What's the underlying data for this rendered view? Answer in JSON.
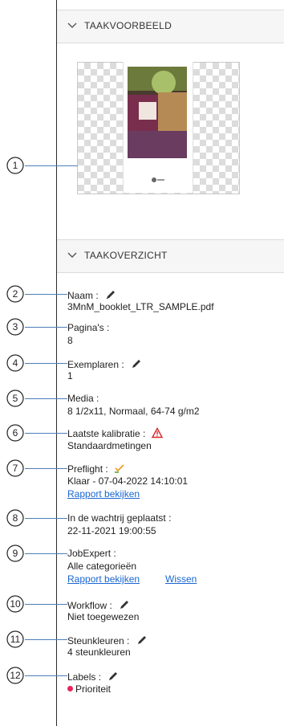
{
  "sections": {
    "preview_title": "TAAKVOORBEELD",
    "summary_title": "TAAKOVERZICHT"
  },
  "callouts": [
    "1",
    "2",
    "3",
    "4",
    "5",
    "6",
    "7",
    "8",
    "9",
    "10",
    "11",
    "12"
  ],
  "fields": {
    "name": {
      "label": "Naam :",
      "value": "3MnM_booklet_LTR_SAMPLE.pdf"
    },
    "pages": {
      "label": "Pagina's :",
      "value": "8"
    },
    "copies": {
      "label": "Exemplaren :",
      "value": "1"
    },
    "media": {
      "label": "Media :",
      "value": "8 1/2x11, Normaal, 64-74 g/m2"
    },
    "calibration": {
      "label": "Laatste kalibratie :",
      "value": "Standaardmetingen"
    },
    "preflight": {
      "label": "Preflight :",
      "value": "Klaar - 07-04-2022 14:10:01",
      "link": "Rapport bekijken"
    },
    "queued": {
      "label": "In de wachtrij geplaatst :",
      "value": "22-11-2021 19:00:55"
    },
    "jobexpert": {
      "label": "JobExpert :",
      "value": "Alle categorieën",
      "link": "Rapport bekijken",
      "link2": "Wissen"
    },
    "workflow": {
      "label": "Workflow :",
      "value": "Niet toegewezen"
    },
    "spot": {
      "label": "Steunkleuren :",
      "value": "4 steunkleuren"
    },
    "labels": {
      "label": "Labels :",
      "value": "Prioriteit"
    }
  },
  "colors": {
    "link": "#1a66d1",
    "warning": "#d9262c",
    "priority_dot": "#e8245a",
    "preflight_ok": "#e89a1c"
  },
  "icons": [
    "chevron-down-icon",
    "edit-pencil-icon",
    "warning-triangle-icon",
    "preflight-check-icon"
  ]
}
